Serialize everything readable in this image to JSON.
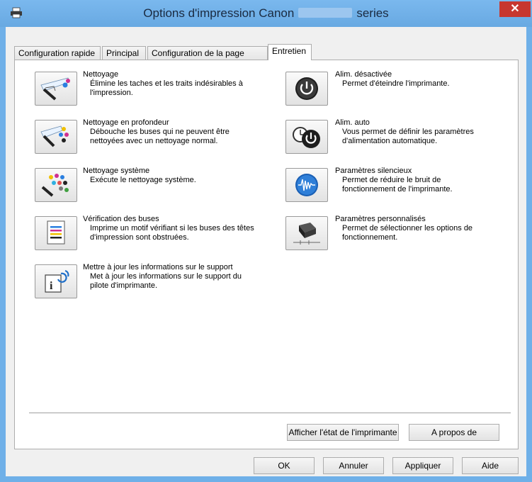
{
  "window": {
    "title_prefix": "Options d'impression Canon",
    "title_suffix": "series",
    "close_label": "✕"
  },
  "tabs": [
    {
      "label": "Configuration rapide"
    },
    {
      "label": "Principal"
    },
    {
      "label": "Configuration de la page"
    },
    {
      "label": "Entretien"
    }
  ],
  "left_items": [
    {
      "title": "Nettoyage",
      "desc": "Élimine les taches et les traits indésirables à l'impression.",
      "icon": "cleaning-icon"
    },
    {
      "title": "Nettoyage en profondeur",
      "desc": "Débouche les buses qui ne peuvent être nettoyées avec un nettoyage normal.",
      "icon": "deep-cleaning-icon"
    },
    {
      "title": "Nettoyage système",
      "desc": "Exécute le nettoyage système.",
      "icon": "system-cleaning-icon"
    },
    {
      "title": "Vérification des buses",
      "desc": "Imprime un motif vérifiant si les buses des têtes d'impression sont obstruées.",
      "icon": "nozzle-check-icon"
    },
    {
      "title": "Mettre à jour les informations sur le support",
      "desc": "Met à jour les informations sur le support du pilote d'imprimante.",
      "icon": "update-media-info-icon"
    }
  ],
  "right_items": [
    {
      "title": "Alim. désactivée",
      "desc": "Permet d'éteindre l'imprimante.",
      "icon": "power-off-icon"
    },
    {
      "title": "Alim. auto",
      "desc": "Vous permet de définir les paramètres d'alimentation automatique.",
      "icon": "auto-power-icon"
    },
    {
      "title": "Paramètres silencieux",
      "desc": "Permet de réduire le bruit de fonctionnement de l'imprimante.",
      "icon": "quiet-settings-icon"
    },
    {
      "title": "Paramètres personnalisés",
      "desc": "Permet de sélectionner les options de fonctionnement.",
      "icon": "custom-settings-icon"
    }
  ],
  "panel_buttons": {
    "status": "Afficher l'état de l'imprimante",
    "about": "A propos de"
  },
  "dialog_buttons": {
    "ok": "OK",
    "cancel": "Annuler",
    "apply": "Appliquer",
    "help": "Aide"
  },
  "colors": {
    "titlebar": "#6fb0e8",
    "close": "#c7372f"
  }
}
